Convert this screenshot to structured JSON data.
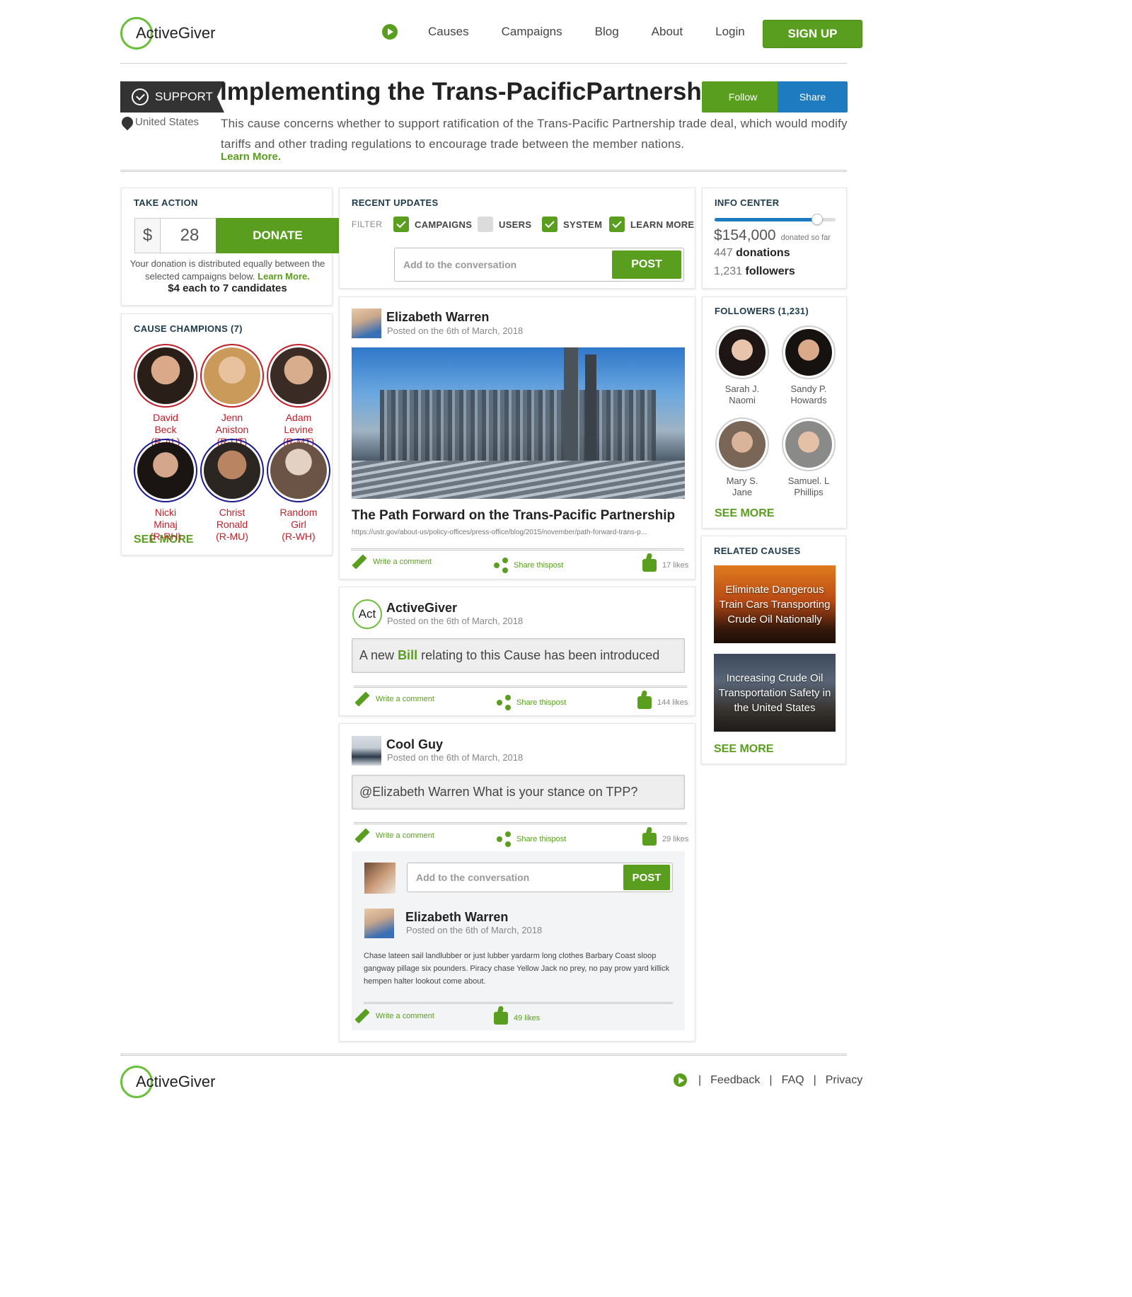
{
  "brand": {
    "logo_text": "ActiveGiver"
  },
  "nav": {
    "causes": "Causes",
    "campaigns": "Campaigns",
    "blog": "Blog",
    "about": "About",
    "login": "Login",
    "signup": "SIGN UP"
  },
  "cause": {
    "tag": "SUPPORT",
    "title": "Implementing the Trans-PacificPartnership",
    "location": "United States",
    "description": "This cause concerns whether to support ratification of the Trans-Pacific Partnership trade deal, which would modify tariffs and other trading regulations to encourage trade between the member nations.",
    "learn_more": "Learn More.",
    "follow_label": "Follow",
    "share_label": "Share"
  },
  "take_action": {
    "title": "TAKE ACTION",
    "currency": "$",
    "amount": "28",
    "donate_label": "DONATE",
    "note": "Your donation is distributed equally between the selected campaigns below.",
    "note_link": "Learn More.",
    "split": "$4 each to 7 candidates"
  },
  "champions": {
    "title": "CAUSE CHAMPIONS (7)",
    "items": [
      {
        "first": "David",
        "last": "Beck",
        "party": "(R-AL)"
      },
      {
        "first": "Jenn",
        "last": "Aniston",
        "party": "(R-UT)"
      },
      {
        "first": "Adam",
        "last": "Levine",
        "party": "(R-MT)"
      },
      {
        "first": "Nicki",
        "last": "Minaj",
        "party": "(R-RH)"
      },
      {
        "first": "Christ",
        "last": "Ronald",
        "party": "(R-MU)"
      },
      {
        "first": "Random",
        "last": "Girl",
        "party": "(R-WH)"
      }
    ],
    "see_more": "SEE MORE"
  },
  "updates": {
    "title": "RECENT UPDATES",
    "filter_label": "FILTER",
    "filters": [
      {
        "label": "CAMPAIGNS",
        "checked": true
      },
      {
        "label": "USERS",
        "checked": false
      },
      {
        "label": "SYSTEM",
        "checked": true
      },
      {
        "label": "LEARN MORE",
        "checked": true
      }
    ],
    "placeholder": "Add to the conversation",
    "post_label": "POST"
  },
  "posts": [
    {
      "author": "Elizabeth Warren",
      "date": "Posted on the 6th of March, 2018",
      "headline": "The Path Forward on the Trans-Pacific Partnership",
      "url": "https://ustr.gov/about-us/policy-offices/press-office/blog/2015/november/path-forward-trans-p...",
      "comment": "Write a comment",
      "share": "Share thispost",
      "likes": "17 likes"
    },
    {
      "author": "ActiveGiver",
      "date": "Posted on the 6th of March, 2018",
      "message_pre": "A new",
      "message_link": "Bill",
      "message_post": "relating to this Cause has been introduced",
      "comment": "Write a comment",
      "share": "Share thispost",
      "likes": "144 likes"
    },
    {
      "author": "Cool Guy",
      "date": "Posted on the 6th of March, 2018",
      "message": "@Elizabeth Warren What is your stance on TPP?",
      "comment": "Write a comment",
      "share": "Share thispost",
      "likes": "29 likes",
      "reply": {
        "placeholder": "Add to the conversation",
        "post_label": "POST",
        "author": "Elizabeth Warren",
        "date": "Posted on the 6th of March, 2018",
        "text": "Chase lateen sail landlubber or just lubber yardarm long clothes Barbary Coast sloop gangway pillage six pounders. Piracy chase Yellow Jack no prey, no pay prow yard killick hempen halter lookout come about.",
        "comment": "Write a comment",
        "likes": "49 likes"
      }
    }
  ],
  "info_center": {
    "title": "INFO CENTER",
    "progress": 0.85,
    "amount": "$154,000",
    "amount_note": "donated so far",
    "donations_count": "447",
    "donations_label": "donations",
    "followers_count": "1,231",
    "followers_label": "followers"
  },
  "followers": {
    "title": "FOLLOWERS (1,231)",
    "items": [
      {
        "first": "Sarah J.",
        "last": "Naomi"
      },
      {
        "first": "Sandy P.",
        "last": "Howards"
      },
      {
        "first": "Mary S.",
        "last": "Jane"
      },
      {
        "first": "Samuel. L",
        "last": "Phillips"
      }
    ],
    "see_more": "SEE MORE"
  },
  "related": {
    "title": "RELATED CAUSES",
    "items": [
      "Eliminate Dangerous Train Cars Transporting Crude Oil Nationally",
      "Increasing Crude Oil Transportation Safety in the United States"
    ],
    "see_more": "SEE MORE"
  },
  "footer": {
    "feedback": "Feedback",
    "faq": "FAQ",
    "privacy": "Privacy",
    "sep": "|"
  },
  "colors": {
    "accent": "#5a9e1f",
    "share": "#1f7bbf",
    "champion_red": "#c0202a",
    "champion_blue": "#1b1b8f"
  }
}
